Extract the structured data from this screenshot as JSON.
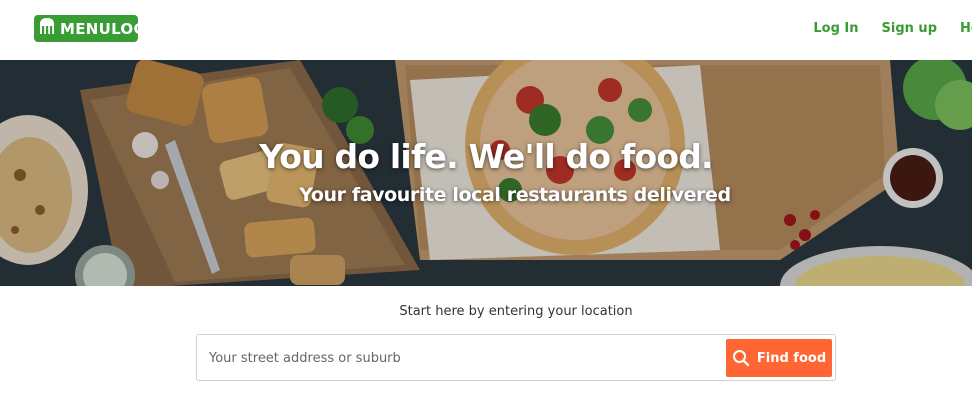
{
  "header": {
    "logo_text": "MENULOG",
    "nav": [
      {
        "label": "Log In"
      },
      {
        "label": "Sign up"
      },
      {
        "label": "He"
      }
    ]
  },
  "hero": {
    "title": "You do life. We'll do food.",
    "subtitle": "Your favourite local restaurants delivered"
  },
  "search": {
    "prompt": "Start here by entering your location",
    "placeholder": "Your street address or suburb",
    "button_label": "Find food",
    "button_icon": "search-icon"
  },
  "colors": {
    "brand_green": "#3a9c35",
    "accent_orange": "#ff6633"
  }
}
